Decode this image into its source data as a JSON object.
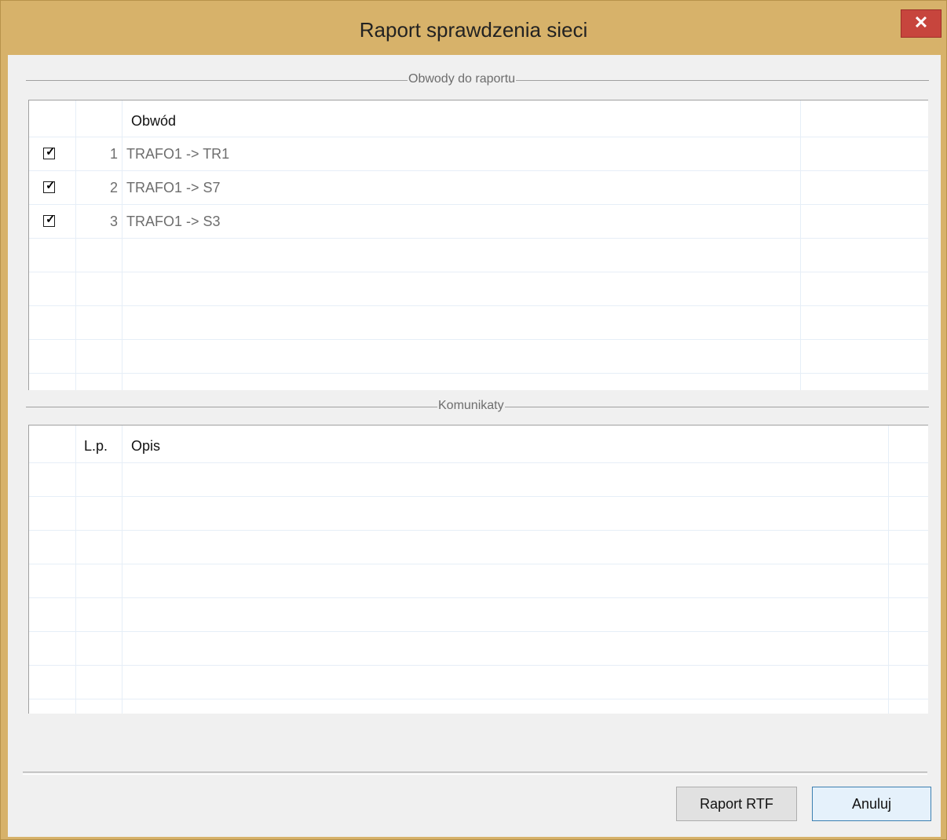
{
  "window": {
    "title": "Raport sprawdzenia sieci",
    "close_glyph": "✕"
  },
  "circuits": {
    "group_title": "Obwody do raportu",
    "columns": [
      "",
      "",
      "Obwód"
    ],
    "rows": [
      {
        "checked": true,
        "num": "1",
        "name": "TRAFO1 -> TR1"
      },
      {
        "checked": true,
        "num": "2",
        "name": "TRAFO1 -> S7"
      },
      {
        "checked": true,
        "num": "3",
        "name": "TRAFO1 -> S3"
      }
    ]
  },
  "messages": {
    "group_title": "Komunikaty",
    "columns": [
      "",
      "L.p.",
      "Opis"
    ]
  },
  "buttons": {
    "report": "Raport RTF",
    "cancel": "Anuluj"
  },
  "colors": {
    "title_bar": "#d7b26a",
    "close_button": "#c7453d",
    "dialog_bg": "#f0f0f0"
  }
}
